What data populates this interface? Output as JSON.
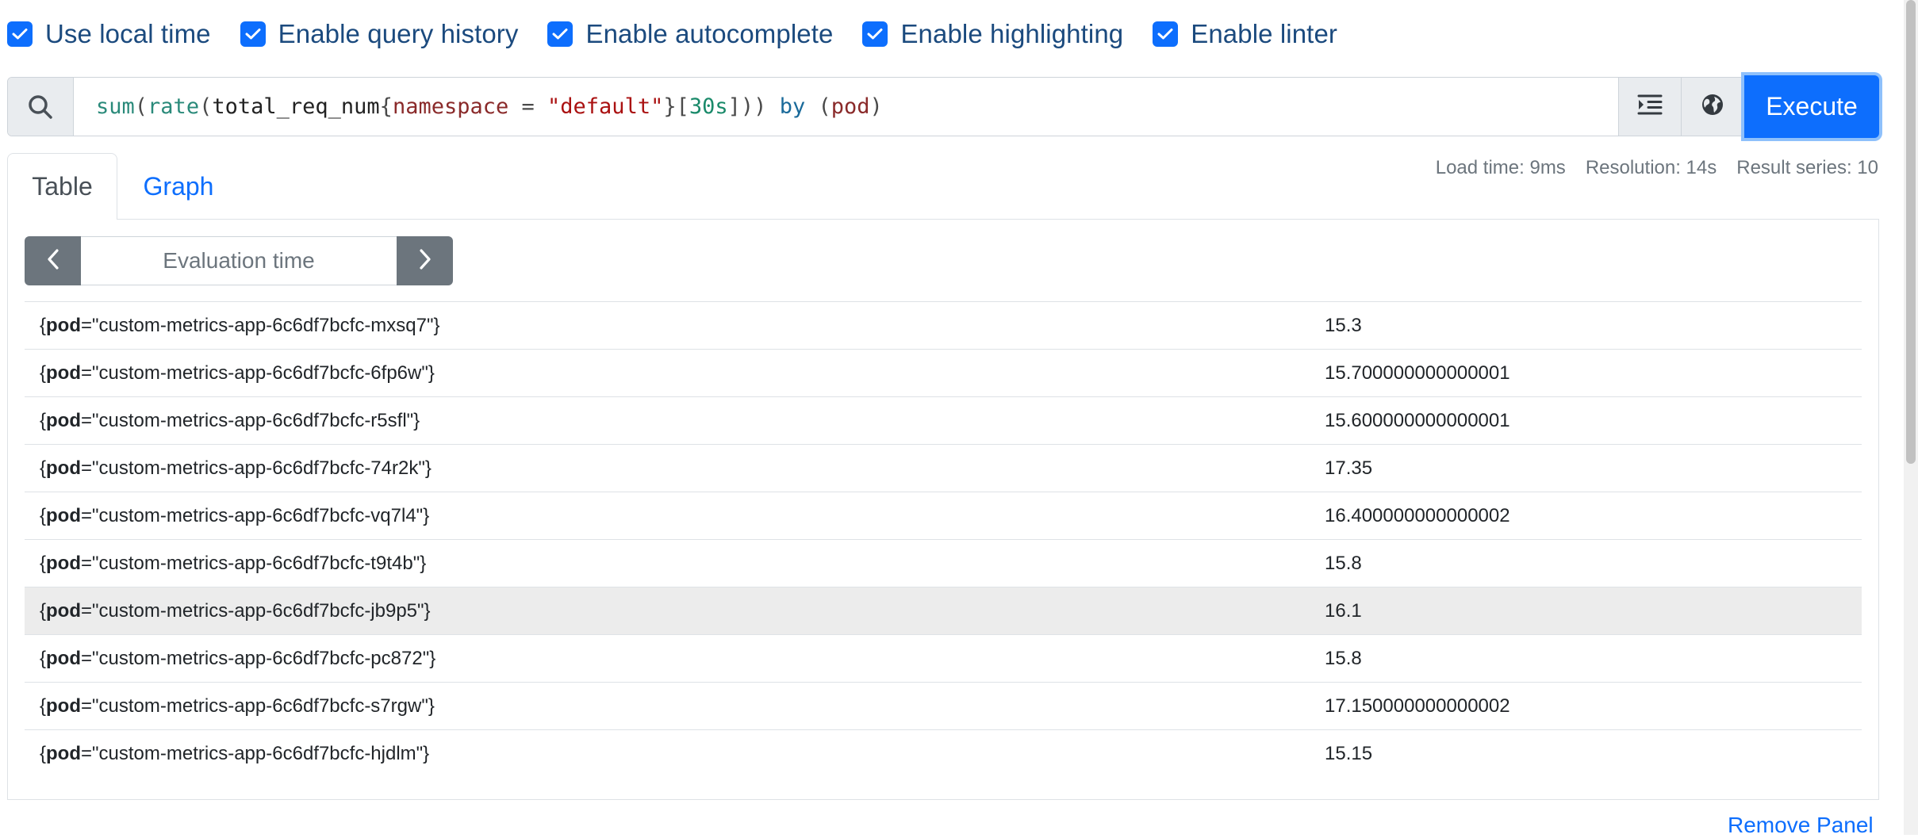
{
  "options": [
    {
      "label": "Use local time",
      "checked": true
    },
    {
      "label": "Enable query history",
      "checked": true
    },
    {
      "label": "Enable autocomplete",
      "checked": true
    },
    {
      "label": "Enable highlighting",
      "checked": true
    },
    {
      "label": "Enable linter",
      "checked": true
    }
  ],
  "query": {
    "tokens": {
      "t0": "sum",
      "t1": "(",
      "t2": "rate",
      "t3": "(",
      "t4": "total_req_num",
      "t5": "{",
      "t6": "namespace",
      "t7": " = ",
      "t8": "\"default\"",
      "t9": "}",
      "t10": "[",
      "t11": "30s",
      "t12": "]",
      "t13": "))",
      "t14": " by ",
      "t15": "(",
      "t16": "pod",
      "t17": ")"
    },
    "execute_label": "Execute"
  },
  "tabs": {
    "table": "Table",
    "graph": "Graph"
  },
  "stats": {
    "load_time": "Load time: 9ms",
    "resolution": "Resolution: 14s",
    "result_series": "Result series: 10"
  },
  "evaluation": {
    "placeholder": "Evaluation time"
  },
  "results": [
    {
      "open": "{",
      "key": "pod",
      "rest": "=\"custom-metrics-app-6c6df7bcfc-mxsq7\"}",
      "value": "15.3"
    },
    {
      "open": "{",
      "key": "pod",
      "rest": "=\"custom-metrics-app-6c6df7bcfc-6fp6w\"}",
      "value": "15.700000000000001"
    },
    {
      "open": "{",
      "key": "pod",
      "rest": "=\"custom-metrics-app-6c6df7bcfc-r5sfl\"}",
      "value": "15.600000000000001"
    },
    {
      "open": "{",
      "key": "pod",
      "rest": "=\"custom-metrics-app-6c6df7bcfc-74r2k\"}",
      "value": "17.35"
    },
    {
      "open": "{",
      "key": "pod",
      "rest": "=\"custom-metrics-app-6c6df7bcfc-vq7l4\"}",
      "value": "16.400000000000002"
    },
    {
      "open": "{",
      "key": "pod",
      "rest": "=\"custom-metrics-app-6c6df7bcfc-t9t4b\"}",
      "value": "15.8"
    },
    {
      "open": "{",
      "key": "pod",
      "rest": "=\"custom-metrics-app-6c6df7bcfc-jb9p5\"}",
      "value": "16.1"
    },
    {
      "open": "{",
      "key": "pod",
      "rest": "=\"custom-metrics-app-6c6df7bcfc-pc872\"}",
      "value": "15.8"
    },
    {
      "open": "{",
      "key": "pod",
      "rest": "=\"custom-metrics-app-6c6df7bcfc-s7rgw\"}",
      "value": "17.150000000000002"
    },
    {
      "open": "{",
      "key": "pod",
      "rest": "=\"custom-metrics-app-6c6df7bcfc-hjdlm\"}",
      "value": "15.15"
    }
  ],
  "remove_panel": "Remove Panel",
  "colors": {
    "accent": "#0d6efd",
    "nav_button": "#6c757d",
    "highlight_row": "#ececec"
  }
}
